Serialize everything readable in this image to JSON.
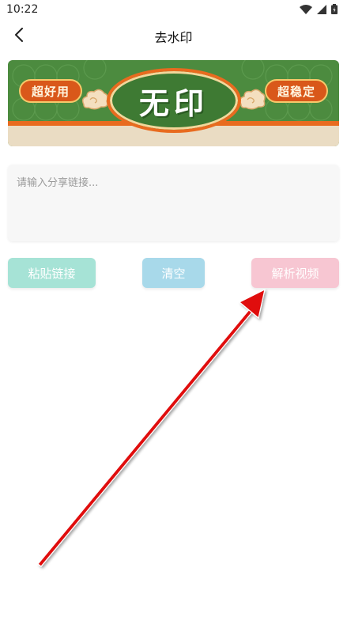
{
  "status_bar": {
    "time": "10:22",
    "icons": [
      "wifi-icon",
      "signal-icon",
      "battery-icon"
    ]
  },
  "app_bar": {
    "title": "去水印",
    "back_icon": "chevron-left-icon"
  },
  "banner": {
    "left_badge": "超好用",
    "center_text": "无印",
    "right_badge": "超稳定"
  },
  "input": {
    "value": "",
    "placeholder": "请输入分享链接..."
  },
  "buttons": {
    "paste_label": "粘贴链接",
    "clear_label": "清空",
    "parse_label": "解析视频"
  },
  "colors": {
    "paste_button": "#a6e3d6",
    "clear_button": "#a8d9ea",
    "parse_button": "#f7c6d2",
    "banner_green": "#4c8b3f",
    "banner_orange": "#e86b1f",
    "annotation_arrow": "#e01010"
  }
}
